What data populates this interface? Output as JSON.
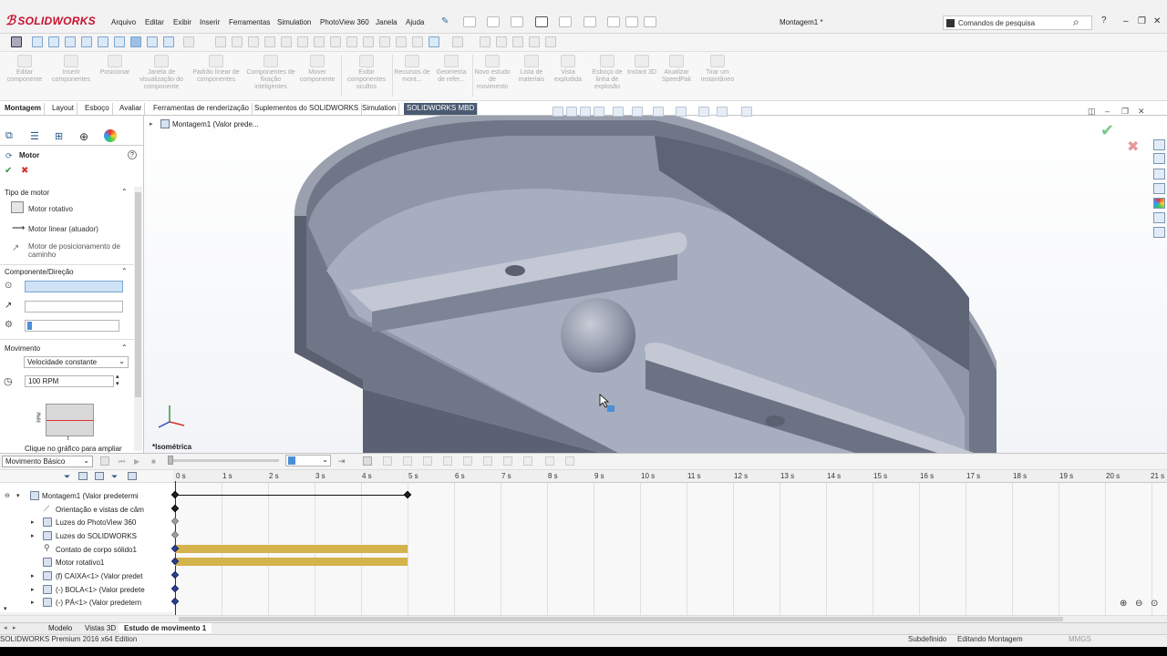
{
  "app": {
    "brand": "SOLIDWORKS",
    "document_title": "Montagem1 *",
    "search_placeholder": "Comandos de pesquisa",
    "help": "?"
  },
  "menu": [
    "Arquivo",
    "Editar",
    "Exibir",
    "Inserir",
    "Ferramentas",
    "Simulation",
    "PhotoView 360",
    "Janela",
    "Ajuda"
  ],
  "ribbon": [
    {
      "label": "Editar componente"
    },
    {
      "label": "Inserir componentes"
    },
    {
      "label": "Posicionar"
    },
    {
      "label": "Janela de visualização do componente"
    },
    {
      "label": "Padrão linear de componentes"
    },
    {
      "label": "Componentes de fixação inteligentes"
    },
    {
      "label": "Mover componente"
    },
    {
      "label": "Exibir componentes ocultos"
    },
    {
      "label": "Recursos de mont..."
    },
    {
      "label": "Geometria de refer..."
    },
    {
      "label": "Novo estudo de movimento"
    },
    {
      "label": "Lista de materiais"
    },
    {
      "label": "Vista explodida"
    },
    {
      "label": "Esboço de linha de explosão"
    },
    {
      "label": "Instant 3D"
    },
    {
      "label": "Atualizar SpeedPak"
    },
    {
      "label": "Tirar um instantâneo"
    }
  ],
  "tabs": [
    "Montagem",
    "Layout",
    "Esboço",
    "Avaliar",
    "Ferramentas de renderização",
    "Suplementos do SOLIDWORKS",
    "Simulation",
    "SOLIDWORKS MBD"
  ],
  "property_manager": {
    "title": "Motor",
    "motor_type": {
      "header": "Tipo de motor",
      "options": [
        "Motor rotativo",
        "Motor linear (atuador)",
        "Motor de posicionamento de caminho"
      ]
    },
    "component": {
      "header": "Componente/Direção"
    },
    "movement": {
      "header": "Movimento",
      "function": "Velocidade constante",
      "speed": "100 RPM",
      "graph_ylabel": "RPM",
      "graph_xlabel": "t",
      "hint": "Clique no gráfico para ampliar"
    }
  },
  "feature_tree_flyout": "Montagem1  (Valor prede...",
  "view_label": "*Isométrica",
  "timeline": {
    "study_type": "Movimento Básico",
    "time_field": "",
    "ticks": [
      "0 s",
      "1 s",
      "2 s",
      "3 s",
      "4 s",
      "5 s",
      "6 s",
      "7 s",
      "8 s",
      "9 s",
      "10 s",
      "11 s",
      "12 s",
      "13 s",
      "14 s",
      "15 s",
      "16 s",
      "17 s",
      "18 s",
      "19 s",
      "20 s",
      "21 s"
    ],
    "tree": [
      {
        "label": "Montagem1  (Valor predetermi",
        "expand": "▾"
      },
      {
        "label": "Orientação e vistas de câm",
        "expand": ""
      },
      {
        "label": "Luzes do PhotoView 360",
        "expand": "▸"
      },
      {
        "label": "Luzes do SOLIDWORKS",
        "expand": "▸"
      },
      {
        "label": "Contato de corpo sólido1",
        "expand": ""
      },
      {
        "label": "Motor rotativo1",
        "expand": ""
      },
      {
        "label": "(f) CAIXA<1> (Valor predet",
        "expand": "▸"
      },
      {
        "label": "(-) BOLA<1> (Valor predete",
        "expand": "▸"
      },
      {
        "label": "(-) PÁ<1> (Valor predetern",
        "expand": "▸"
      }
    ]
  },
  "bottom_tabs": [
    "Modelo",
    "Vistas 3D",
    "Estudo de movimento 1"
  ],
  "status": {
    "edition": "SOLIDWORKS Premium 2016 x64 Edition",
    "state": "Subdefinido",
    "mode": "Editando Montagem",
    "units": "MMGS"
  },
  "colors": {
    "brand_red": "#c8102e",
    "bar_gold": "#d4b24c",
    "model_grey": "#8d94a6",
    "accept_green": "#2e9b3f",
    "cancel_red": "#d0342c"
  }
}
